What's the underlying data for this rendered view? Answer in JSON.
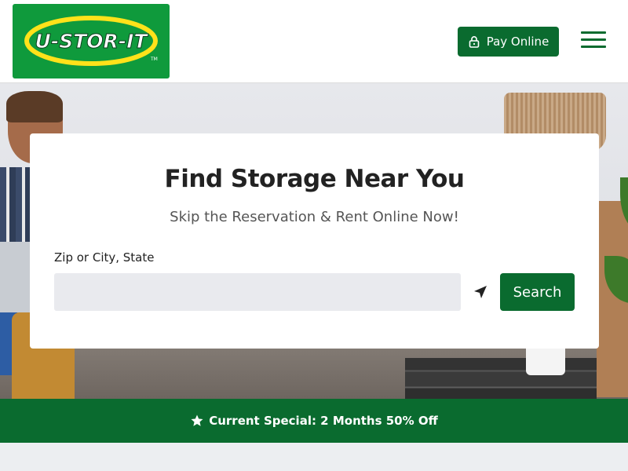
{
  "header": {
    "logo_text": "U-STOR-IT",
    "logo_tm": "TM",
    "pay_label": "Pay Online"
  },
  "search": {
    "title": "Find Storage Near You",
    "subtitle": "Skip the Reservation & Rent Online Now!",
    "field_label": "Zip or City, State",
    "input_value": "",
    "placeholder": "",
    "button_label": "Search"
  },
  "special": {
    "text": "Current Special: 2 Months 50% Off"
  },
  "colors": {
    "brand_green": "#0a6b2f",
    "logo_green": "#0f9a3c",
    "logo_yellow": "#ffe21a"
  },
  "icons": {
    "lock": "lock-icon",
    "menu": "hamburger-menu-icon",
    "locate": "location-arrow-icon",
    "star": "star-icon"
  }
}
